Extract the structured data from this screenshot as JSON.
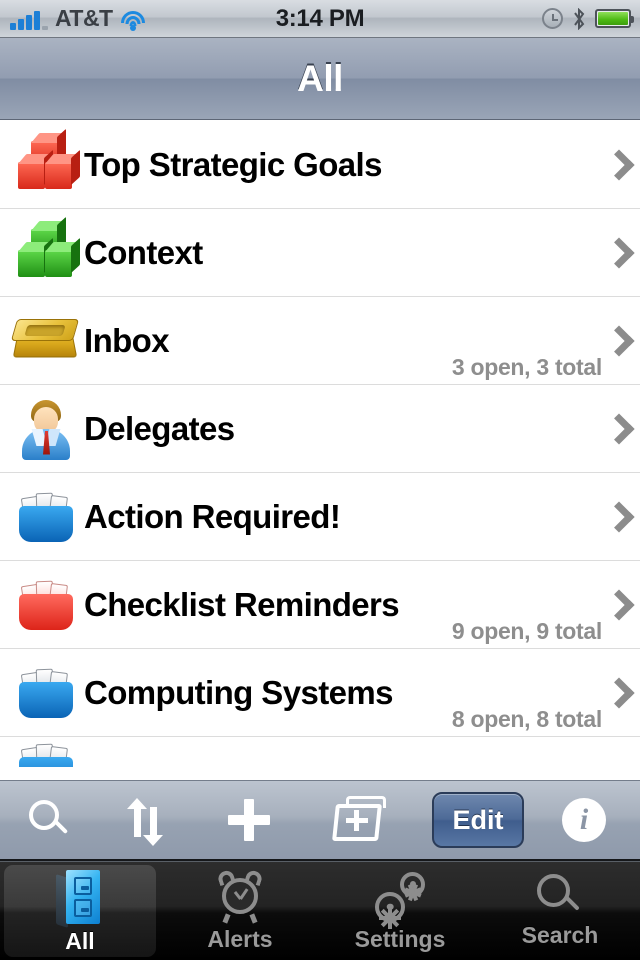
{
  "status_bar": {
    "carrier": "AT&T",
    "time": "3:14 PM",
    "signal_bars_filled": 4,
    "signal_bars_total": 5,
    "wifi_icon": "wifi-icon",
    "alarm_icon": "alarm-clock-icon",
    "bluetooth_icon": "bluetooth-icon",
    "battery_icon": "battery-full-icon",
    "battery_level": "100%"
  },
  "nav_bar": {
    "title": "All"
  },
  "list": {
    "rows": [
      {
        "title": "Top Strategic Goals",
        "subtitle": "",
        "icon": "red-cubes-icon",
        "accessory": "chevron-right-icon"
      },
      {
        "title": "Context",
        "subtitle": "",
        "icon": "green-cubes-icon",
        "accessory": "chevron-right-icon"
      },
      {
        "title": "Inbox",
        "subtitle": "3 open, 3 total",
        "icon": "gold-inbox-tray-icon",
        "accessory": "chevron-right-icon"
      },
      {
        "title": "Delegates",
        "subtitle": "",
        "icon": "person-businessman-icon",
        "accessory": "chevron-right-icon"
      },
      {
        "title": "Action Required!",
        "subtitle": "",
        "icon": "blue-card-file-icon",
        "accessory": "chevron-right-icon"
      },
      {
        "title": "Checklist Reminders",
        "subtitle": "9 open, 9 total",
        "icon": "red-card-file-icon",
        "accessory": "chevron-right-icon"
      },
      {
        "title": "Computing Systems",
        "subtitle": "8 open, 8 total",
        "icon": "blue-card-file-icon",
        "accessory": "chevron-right-icon"
      },
      {
        "title": "",
        "subtitle": "",
        "icon": "card-file-icon-partial",
        "accessory": ""
      }
    ]
  },
  "toolbar": {
    "search_icon": "search-icon",
    "sort_icon": "sort-updown-icon",
    "add_icon": "plus-icon",
    "new_folder_icon": "new-folder-icon",
    "edit_label": "Edit",
    "info_icon": "info-icon"
  },
  "tab_bar": {
    "tabs": [
      {
        "label": "All",
        "icon": "filing-cabinet-icon",
        "active": true
      },
      {
        "label": "Alerts",
        "icon": "alarm-clock-icon",
        "active": false
      },
      {
        "label": "Settings",
        "icon": "gears-icon",
        "active": false
      },
      {
        "label": "Search",
        "icon": "search-icon",
        "active": false
      }
    ]
  },
  "colors": {
    "nav_bar_blue_gray": "#929db1",
    "row_title_black": "#000000",
    "subtitle_gray": "#8e8e8e",
    "chevron_gray": "#8c8c8c",
    "edit_button_blue": "#4d6a97",
    "tab_active_white": "#ffffff",
    "tab_inactive_gray": "#9a9a9a",
    "signal_blue": "#1c7fd6",
    "battery_green": "#4cb913",
    "cube_red": "#f03c28",
    "cube_green": "#3ab523",
    "tray_gold": "#d9a81c",
    "card_file_blue": "#0d7fd0",
    "card_file_red": "#ef3b32"
  }
}
